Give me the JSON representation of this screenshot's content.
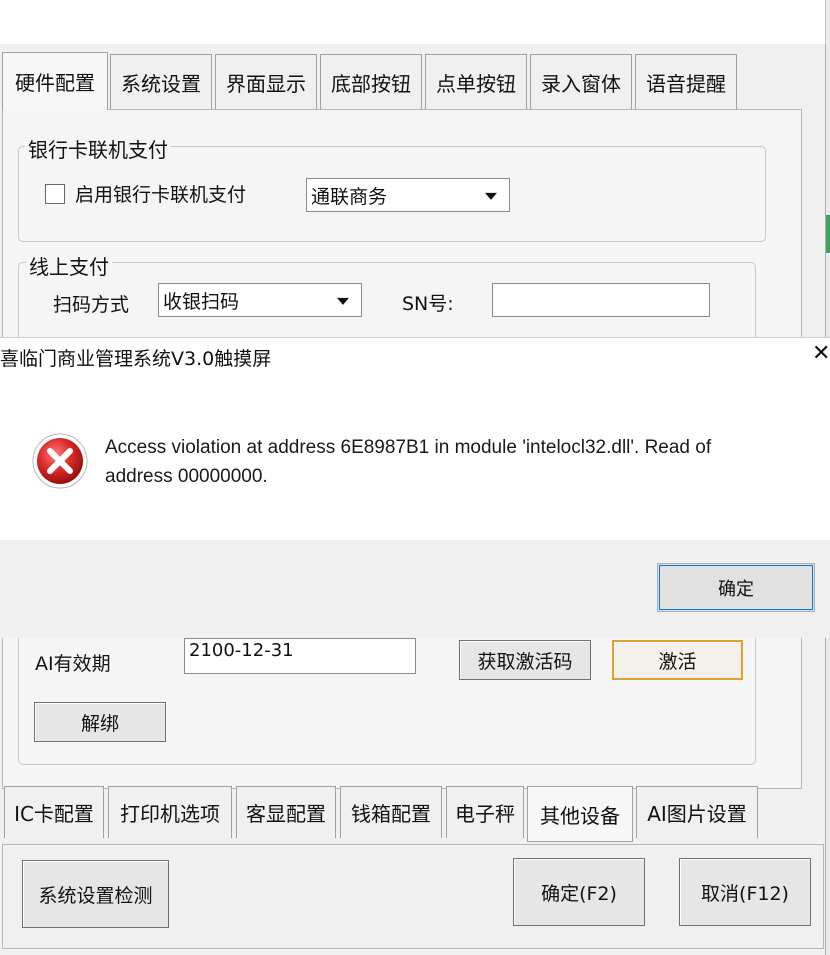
{
  "top_tabs": [
    "硬件配置",
    "系统设置",
    "界面显示",
    "底部按钮",
    "点单按钮",
    "录入窗体",
    "语音提醒"
  ],
  "bank_group": {
    "title": "银行卡联机支付",
    "checkbox_label": "启用银行卡联机支付",
    "checked": false,
    "provider": "通联商务"
  },
  "online_group": {
    "title": "线上支付",
    "scan_label": "扫码方式",
    "scan_value": "收银扫码",
    "sn_label": "SN号:",
    "sn_value": ""
  },
  "ai_section": {
    "expiry_label": "AI有效期",
    "expiry_value": "2100-12-31",
    "get_code_button": "获取激活码",
    "activate_button": "激活",
    "unbind_button": "解绑"
  },
  "bottom_tabs": [
    "IC卡配置",
    "打印机选项",
    "客显配置",
    "钱箱配置",
    "电子秤",
    "其他设备",
    "AI图片设置"
  ],
  "footer": {
    "check_button": "系统设置检测",
    "ok_button": "确定(F2)",
    "cancel_button": "取消(F12)"
  },
  "dialog": {
    "title": "喜临门商业管理系统V3.0触摸屏",
    "message_line1": "Access violation at address 6E8987B1 in module 'intelocl32.dll'. Read of",
    "message_line2": "address 00000000.",
    "ok_label": "确定",
    "icon": "error-icon"
  },
  "colors": {
    "error_red": "#d82a2a",
    "focus_orange": "#e0a030",
    "dialog_focus_blue": "#0078d7"
  }
}
